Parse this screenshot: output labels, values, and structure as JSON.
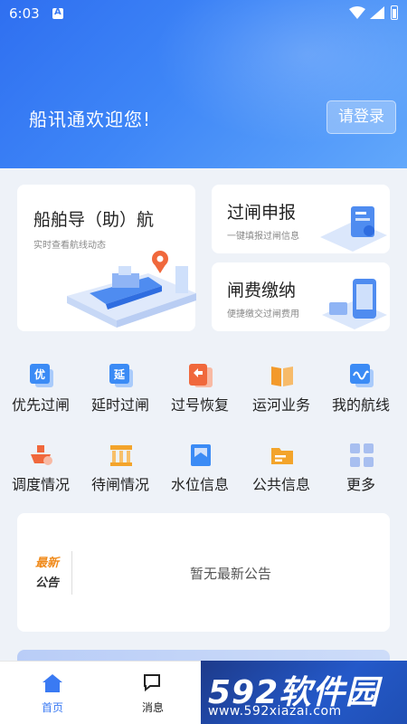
{
  "status_bar": {
    "time": "6:03"
  },
  "header": {
    "welcome": "船讯通欢迎您!",
    "login_label": "请登录"
  },
  "cards": {
    "navigation": {
      "title": "船舶导（助）航",
      "subtitle": "实时查看航线动态"
    },
    "lock_report": {
      "title": "过闸申报",
      "subtitle": "一键填报过闸信息"
    },
    "fee_payment": {
      "title": "闸费缴纳",
      "subtitle": "便捷缴交过闸费用"
    }
  },
  "grid": {
    "row1": [
      {
        "label": "优先过闸",
        "icon": "priority-icon",
        "glyph": "优",
        "color": "#3b8bf5"
      },
      {
        "label": "延时过闸",
        "icon": "delay-icon",
        "glyph": "延",
        "color": "#3b8bf5"
      },
      {
        "label": "过号恢复",
        "icon": "number-restore-icon",
        "glyph": "",
        "color": "#f0683c"
      },
      {
        "label": "运河业务",
        "icon": "canal-book-icon",
        "glyph": "",
        "color": "#f39a2b"
      },
      {
        "label": "我的航线",
        "icon": "route-icon",
        "glyph": "",
        "color": "#3b8bf5"
      }
    ],
    "row2": [
      {
        "label": "调度情况",
        "icon": "dispatch-ship-icon",
        "glyph": "",
        "color": "#f0683c"
      },
      {
        "label": "待闸情况",
        "icon": "waiting-gate-icon",
        "glyph": "",
        "color": "#f3a42b"
      },
      {
        "label": "水位信息",
        "icon": "water-level-icon",
        "glyph": "",
        "color": "#3b8bf5"
      },
      {
        "label": "公共信息",
        "icon": "public-info-icon",
        "glyph": "",
        "color": "#f3a42b"
      },
      {
        "label": "更多",
        "icon": "more-grid-icon",
        "glyph": "",
        "color": "#a8bff0"
      }
    ]
  },
  "notice": {
    "badge_top": "最新",
    "badge_bottom": "公告",
    "text": "暂无最新公告"
  },
  "tabbar": {
    "home": "首页",
    "messages": "消息",
    "home_color": "#3a7af3"
  },
  "watermark": {
    "brand": "592软件园",
    "url": "www.592xiazai.com"
  }
}
